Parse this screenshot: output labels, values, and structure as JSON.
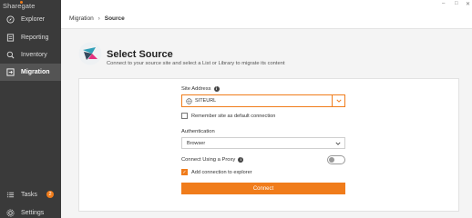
{
  "app": {
    "brand": "Sharegate"
  },
  "sidebar": {
    "items": [
      {
        "label": "Explorer",
        "icon": "explorer-icon"
      },
      {
        "label": "Reporting",
        "icon": "reporting-icon"
      },
      {
        "label": "Inventory",
        "icon": "inventory-icon"
      },
      {
        "label": "Migration",
        "icon": "migration-icon",
        "active": true
      }
    ],
    "bottom": [
      {
        "label": "Tasks",
        "icon": "tasks-icon",
        "badge": "2"
      },
      {
        "label": "Settings",
        "icon": "settings-icon"
      }
    ]
  },
  "window": {
    "minimize": "–",
    "maximize": "□",
    "close": "✕"
  },
  "breadcrumb": {
    "root": "Migration",
    "separator": "›",
    "current": "Source"
  },
  "header": {
    "title": "Select Source",
    "subtitle": "Connect to your source site and select a List or Library to migrate its content"
  },
  "form": {
    "site_address_label": "Site Address",
    "site_address_value": "SITEURL",
    "remember_label": "Remember site as default connection",
    "remember_checked": false,
    "auth_label": "Authentication",
    "auth_value": "Browser",
    "proxy_label": "Connect Using a Proxy",
    "proxy_on": false,
    "add_explorer_label": "Add connection to explorer",
    "add_explorer_checked": true,
    "connect_label": "Connect"
  },
  "colors": {
    "accent": "#f07c1b",
    "sidebar": "#3a3a3a",
    "sidebar_active": "#545454"
  }
}
